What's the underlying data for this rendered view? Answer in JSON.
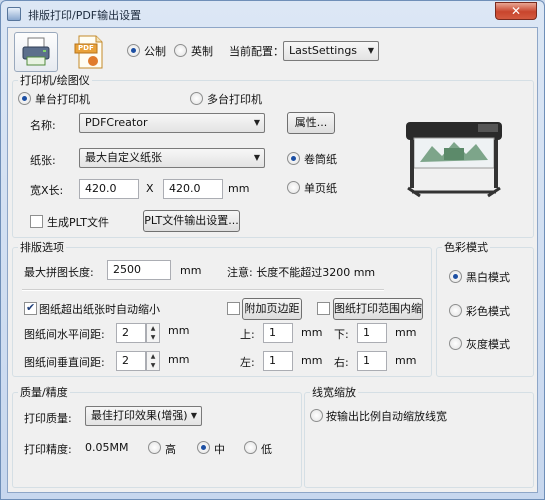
{
  "window": {
    "title": "排版打印/PDF输出设置",
    "close_symbol": "✕"
  },
  "toolbar": {
    "printer_icon": "printer-icon",
    "pdf_icon": "pdf-icon",
    "pdf_text": "PDF",
    "units": [
      {
        "label": "公制",
        "selected": true
      },
      {
        "label": "英制",
        "selected": false
      }
    ],
    "config_label": "当前配置：",
    "config_value": "LastSettings"
  },
  "printer": {
    "group_title": "打印机/绘图仪",
    "mode_single": "单台打印机",
    "mode_multi": "多台打印机",
    "name_label": "名称:",
    "name_value": "PDFCreator",
    "properties_button": "属性...",
    "paper_label": "纸张:",
    "paper_value": "最大自定义纸张",
    "roll_paper": "卷筒纸",
    "sheet_paper": "单页纸",
    "size_label": "宽X长:",
    "width_value": "420.0",
    "x_sep": "X",
    "length_value": "420.0",
    "size_unit": "mm",
    "gen_plt": "生成PLT文件",
    "plt_settings_button": "PLT文件输出设置..."
  },
  "layout": {
    "group_title": "排版选项",
    "max_length_label": "最大拼图长度:",
    "max_length_value": "2500",
    "max_length_unit": "mm",
    "note": "注意: 长度不能超过3200 mm",
    "auto_shrink": "图纸超出纸张时自动缩小",
    "add_margin": "附加页边距",
    "shrink_in_range": "图纸打印范围内缩",
    "h_gap_label": "图纸间水平间距:",
    "h_gap_value": "2",
    "v_gap_label": "图纸间垂直间距:",
    "v_gap_value": "2",
    "gap_unit": "mm",
    "top_label": "上:",
    "top_value": "1",
    "bottom_label": "下:",
    "bottom_value": "1",
    "left_label": "左:",
    "left_value": "1",
    "right_label": "右:",
    "right_value": "1",
    "margin_unit": "mm"
  },
  "color": {
    "group_title": "色彩模式",
    "bw": "黑白模式",
    "color": "彩色模式",
    "gray": "灰度模式"
  },
  "quality": {
    "group_title": "质量/精度",
    "print_quality_label": "打印质量:",
    "print_quality_value": "最佳打印效果(增强)",
    "precision_label": "打印精度:",
    "precision_value": "0.05MM",
    "high": "高",
    "mid": "中",
    "low": "低"
  },
  "linewidth": {
    "group_title": "线宽缩放",
    "scale_by_ratio": "按输出比例自动缩放线宽"
  }
}
